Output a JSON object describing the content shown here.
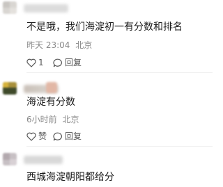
{
  "comments": [
    {
      "text": "不是哦，我们海淀初一有分数和排名",
      "time": "昨天 23:04",
      "location": "北京",
      "like_icon": "heart-icon",
      "like_count": "1",
      "reply_icon": "chat-bubble-icon",
      "reply_label": "回复"
    },
    {
      "text": "海淀有分数",
      "time": "6小时前",
      "location": "北京",
      "like_icon": "heart-icon",
      "like_label": "赞",
      "reply_icon": "chat-bubble-icon",
      "reply_label": "回复"
    },
    {
      "text": "西城海淀朝阳都给分"
    }
  ]
}
